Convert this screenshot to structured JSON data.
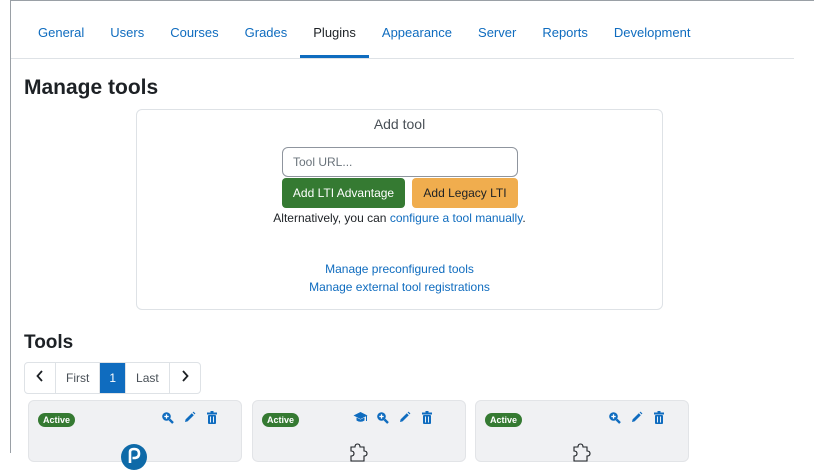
{
  "nav": {
    "tabs": [
      {
        "label": "General"
      },
      {
        "label": "Users"
      },
      {
        "label": "Courses"
      },
      {
        "label": "Grades"
      },
      {
        "label": "Plugins"
      },
      {
        "label": "Appearance"
      },
      {
        "label": "Server"
      },
      {
        "label": "Reports"
      },
      {
        "label": "Development"
      }
    ],
    "active_tab": "Plugins"
  },
  "page_title": "Manage tools",
  "add_tool": {
    "title": "Add tool",
    "url_placeholder": "Tool URL...",
    "add_advantage_label": "Add LTI Advantage",
    "add_legacy_label": "Add Legacy LTI",
    "alt_prefix": "Alternatively, you can",
    "alt_link": "configure a tool manually",
    "alt_suffix": ".",
    "manage_preconfigured": "Manage preconfigured tools",
    "manage_registrations": "Manage external tool registrations"
  },
  "tools": {
    "heading": "Tools",
    "pagination": {
      "first": "First",
      "current": "1",
      "last": "Last"
    },
    "cards": [
      {
        "status": "Active",
        "icons": [
          "search-plus-icon",
          "pencil-icon",
          "trash-icon"
        ],
        "logo": "pearson-logo"
      },
      {
        "status": "Active",
        "icons": [
          "graduation-cap-icon",
          "search-plus-icon",
          "pencil-icon",
          "trash-icon"
        ],
        "logo": "puzzle-icon"
      },
      {
        "status": "Active",
        "icons": [
          "search-plus-icon",
          "pencil-icon",
          "trash-icon"
        ],
        "logo": "puzzle-icon"
      }
    ]
  },
  "colors": {
    "link": "#0f6cbf",
    "success": "#357a32",
    "warning": "#f0ad4e",
    "card_bg": "#f0f1f3"
  }
}
